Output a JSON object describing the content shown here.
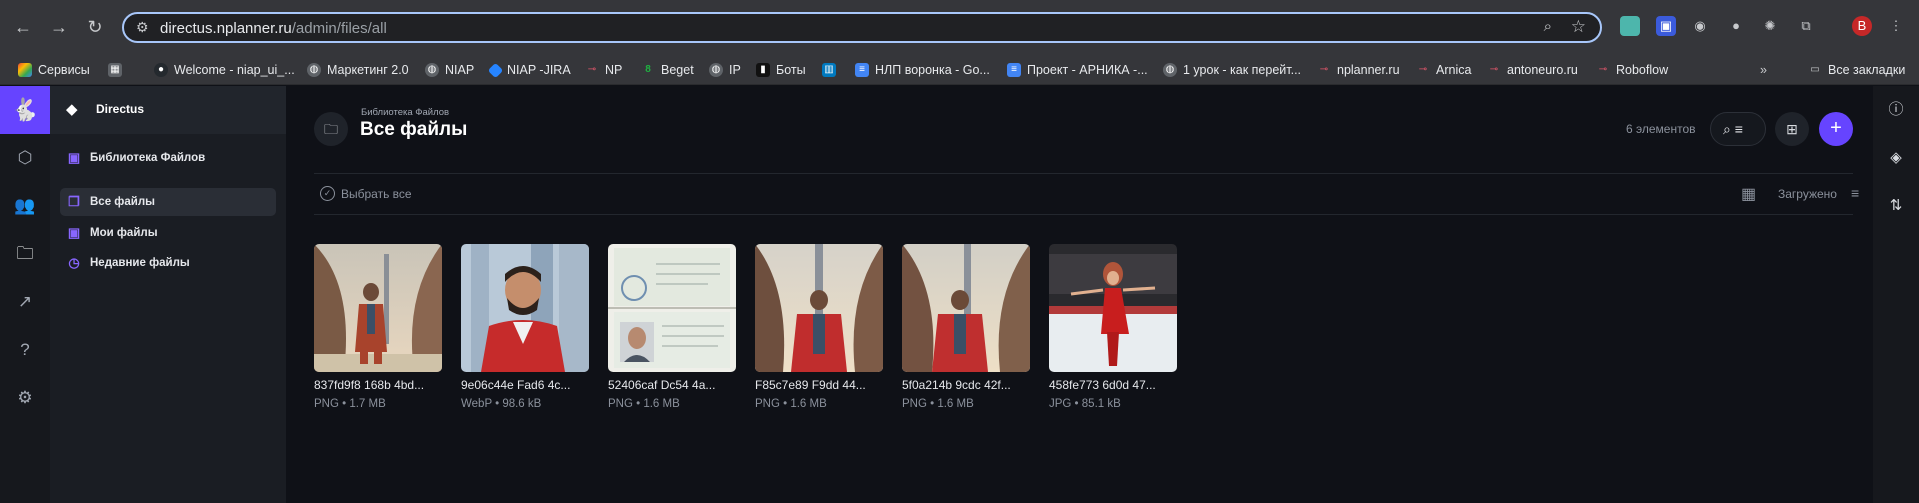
{
  "browser": {
    "url_host": "directus.nplanner.ru",
    "url_path": "/admin/files/all",
    "bookmarks": [
      {
        "label": "Сервисы",
        "icon": "grid-icon",
        "color": "#ea4335"
      },
      {
        "label": "",
        "icon": "apps-icon",
        "color": "#5f6368"
      },
      {
        "label": "Welcome - niap_ui_...",
        "icon": "github-icon",
        "color": "#24292e"
      },
      {
        "label": "Маркетинг 2.0",
        "icon": "globe-icon",
        "color": "#5f6368"
      },
      {
        "label": "NIAP",
        "icon": "globe-icon",
        "color": "#5f6368"
      },
      {
        "label": "NIAP -JIRA",
        "icon": "jira-icon",
        "color": "#2684ff"
      },
      {
        "label": "NP",
        "icon": "link-icon",
        "color": "#e0566b"
      },
      {
        "label": "Beget",
        "icon": "beget-icon",
        "color": "#1fb141"
      },
      {
        "label": "IP",
        "icon": "globe-icon",
        "color": "#5f6368"
      },
      {
        "label": "Боты",
        "icon": "bots-icon",
        "color": "#111111"
      },
      {
        "label": "",
        "icon": "trello-icon",
        "color": "#0079bf"
      },
      {
        "label": "НЛП воронка - Go...",
        "icon": "doc-icon",
        "color": "#4285f4"
      },
      {
        "label": "Проект - АРНИКА -...",
        "icon": "doc-icon",
        "color": "#4285f4"
      },
      {
        "label": "1 урок - как перейт...",
        "icon": "globe-icon",
        "color": "#5f6368"
      },
      {
        "label": "nplanner.ru",
        "icon": "link-icon",
        "color": "#e0566b"
      },
      {
        "label": "Arnica",
        "icon": "link-icon",
        "color": "#e0566b"
      },
      {
        "label": "antoneuro.ru",
        "icon": "link-icon",
        "color": "#e0566b"
      },
      {
        "label": "Roboflow",
        "icon": "link-icon",
        "color": "#e0566b"
      }
    ],
    "all_bookmarks": "Все закладки"
  },
  "nav": {
    "project": "Directus",
    "root": "Библиотека Файлов",
    "items": [
      {
        "label": "Все файлы"
      },
      {
        "label": "Мои файлы"
      },
      {
        "label": "Недавние файлы"
      }
    ]
  },
  "header": {
    "breadcrumb": "Библиотека Файлов",
    "title": "Все файлы",
    "count": "6 элементов"
  },
  "toolbar": {
    "select_all": "Выбрать все",
    "sort": "Загружено"
  },
  "files": [
    {
      "title": "837fd9f8 168b 4bd...",
      "meta": "PNG • 1.7 MB",
      "thumb": "tower-man-red-jacket"
    },
    {
      "title": "9e06c44e Fad6 4c...",
      "meta": "WebP • 98.6 kB",
      "thumb": "portrait-man-red-jacket"
    },
    {
      "title": "52406caf Dc54 4a...",
      "meta": "PNG • 1.6 MB",
      "thumb": "passport-page"
    },
    {
      "title": "F85c7e89 F9dd 44...",
      "meta": "PNG • 1.6 MB",
      "thumb": "tower-man-red-jacket"
    },
    {
      "title": "5f0a214b 9cdc 42f...",
      "meta": "PNG • 1.6 MB",
      "thumb": "tower-man-red-jacket"
    },
    {
      "title": "458fe773 6d0d 47...",
      "meta": "JPG • 85.1 kB",
      "thumb": "skater-red-dress"
    }
  ],
  "colors": {
    "accent": "#6644ff"
  }
}
